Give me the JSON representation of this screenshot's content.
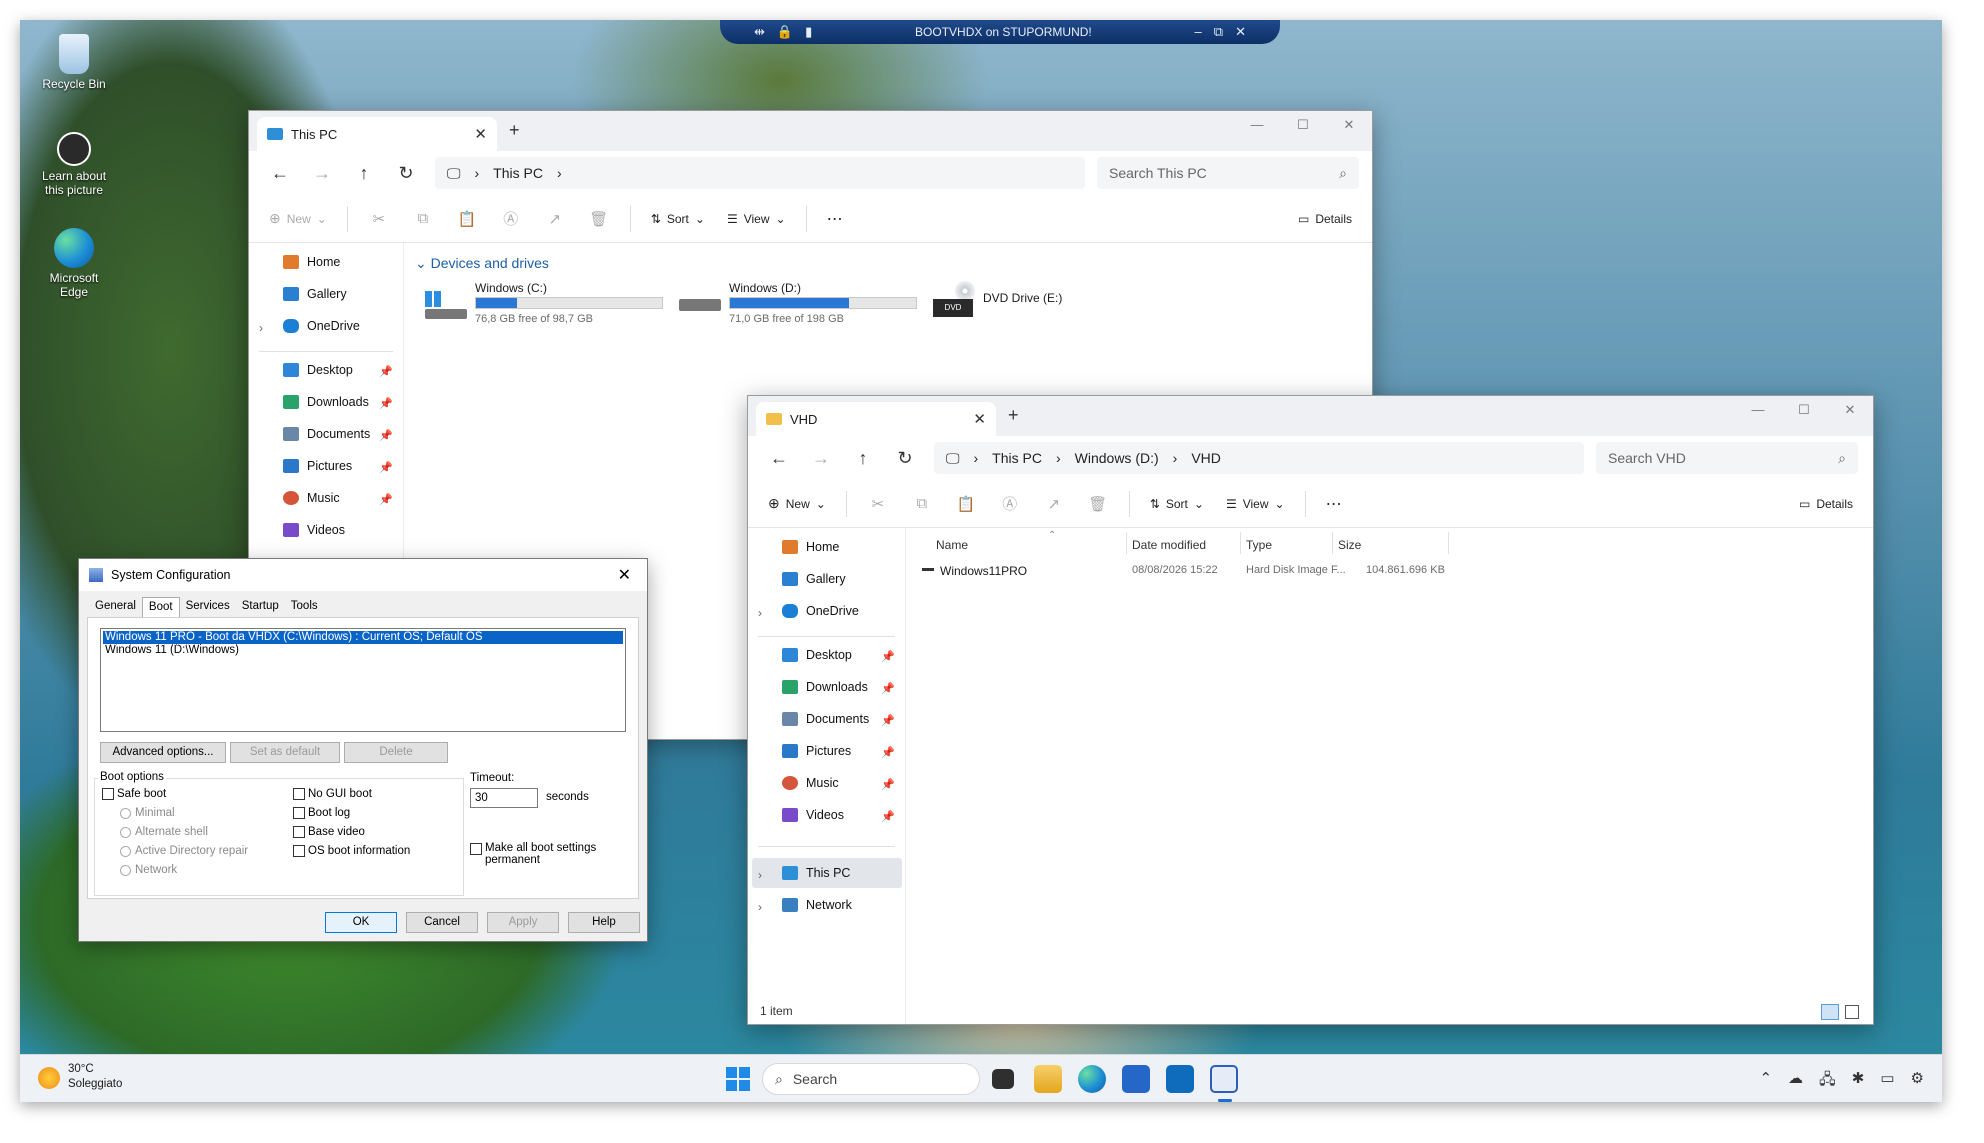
{
  "rdp_bar": {
    "title": "BOOTVHDX on STUPORMUND!"
  },
  "desktop": {
    "icons": [
      {
        "name": "Recycle Bin"
      },
      {
        "name": "Learn about this picture"
      },
      {
        "name": "Microsoft Edge"
      }
    ]
  },
  "explorer_thispc": {
    "tab_title": "This PC",
    "breadcrumb": [
      "This PC"
    ],
    "search_placeholder": "Search This PC",
    "cmd": {
      "new": "New",
      "sort": "Sort",
      "view": "View",
      "details": "Details"
    },
    "sidebar": [
      {
        "label": "Home",
        "pinned": false
      },
      {
        "label": "Gallery",
        "pinned": false
      },
      {
        "label": "OneDrive",
        "pinned": false
      },
      {
        "label": "Desktop",
        "pinned": true
      },
      {
        "label": "Downloads",
        "pinned": true
      },
      {
        "label": "Documents",
        "pinned": true
      },
      {
        "label": "Pictures",
        "pinned": true
      },
      {
        "label": "Music",
        "pinned": true
      },
      {
        "label": "Videos",
        "pinned": true
      }
    ],
    "section_title": "Devices and drives",
    "drives": [
      {
        "name": "Windows (C:)",
        "free": "76,8 GB free of 98,7 GB",
        "used_fraction": 0.22
      },
      {
        "name": "Windows (D:)",
        "free": "71,0 GB free of 198 GB",
        "used_fraction": 0.64
      },
      {
        "name": "DVD Drive (E:)",
        "badge": "DVD"
      }
    ]
  },
  "explorer_vhd": {
    "tab_title": "VHD",
    "breadcrumb": [
      "This PC",
      "Windows (D:)",
      "VHD"
    ],
    "search_placeholder": "Search VHD",
    "cmd": {
      "new": "New",
      "sort": "Sort",
      "view": "View",
      "details": "Details"
    },
    "sidebar": [
      {
        "label": "Home"
      },
      {
        "label": "Gallery"
      },
      {
        "label": "OneDrive"
      },
      {
        "label": "Desktop"
      },
      {
        "label": "Downloads"
      },
      {
        "label": "Documents"
      },
      {
        "label": "Pictures"
      },
      {
        "label": "Music"
      },
      {
        "label": "Videos"
      },
      {
        "label": "This PC"
      },
      {
        "label": "Network"
      }
    ],
    "columns": [
      "Name",
      "Date modified",
      "Type",
      "Size"
    ],
    "rows": [
      {
        "name": "Windows11PRO",
        "date": "08/08/2026 15:22",
        "type": "Hard Disk Image F...",
        "size": "104.861.696 KB"
      }
    ],
    "status": "1 item"
  },
  "msconfig": {
    "title": "System Configuration",
    "tabs": [
      "General",
      "Boot",
      "Services",
      "Startup",
      "Tools"
    ],
    "active_tab": "Boot",
    "boot_entries": [
      "Windows 11 PRO - Boot da VHDX (C:\\Windows) : Current OS; Default OS",
      "Windows 11 (D:\\Windows)"
    ],
    "buttons": {
      "advanced": "Advanced options...",
      "set_default": "Set as default",
      "delete": "Delete",
      "ok": "OK",
      "cancel": "Cancel",
      "apply": "Apply",
      "help": "Help"
    },
    "boot_options_label": "Boot options",
    "safe_boot": "Safe boot",
    "safe_modes": [
      "Minimal",
      "Alternate shell",
      "Active Directory repair",
      "Network"
    ],
    "right_options": [
      "No GUI boot",
      "Boot log",
      "Base video",
      "OS boot information"
    ],
    "timeout_label": "Timeout:",
    "timeout_value": "30",
    "timeout_unit": "seconds",
    "make_permanent": "Make all boot settings permanent"
  },
  "taskbar": {
    "weather_temp": "30°C",
    "weather_desc": "Soleggiato",
    "search_placeholder": "Search"
  }
}
